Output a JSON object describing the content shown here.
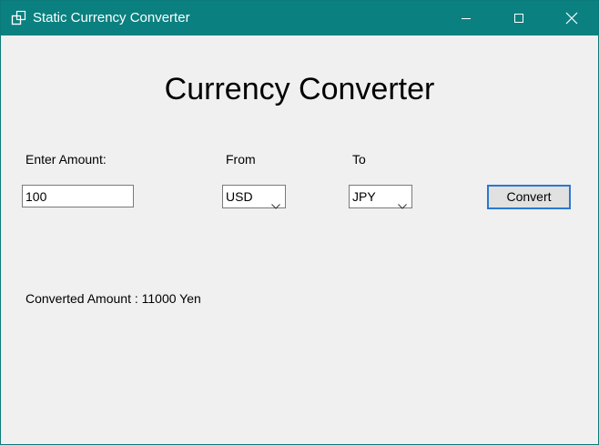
{
  "window": {
    "title": "Static Currency Converter",
    "accent_color": "#0b8080"
  },
  "main": {
    "heading": "Currency Converter",
    "amount_label": "Enter Amount:",
    "from_label": "From",
    "to_label": "To",
    "amount_value": "100",
    "from_currency": "USD",
    "to_currency": "JPY",
    "convert_label": "Convert",
    "result_text": "Converted Amount : 11000 Yen"
  },
  "icons": {
    "app": "app-window-icon",
    "minimize": "minimize-icon",
    "maximize": "maximize-icon",
    "close": "close-icon",
    "dropdown": "chevron-down-icon"
  }
}
